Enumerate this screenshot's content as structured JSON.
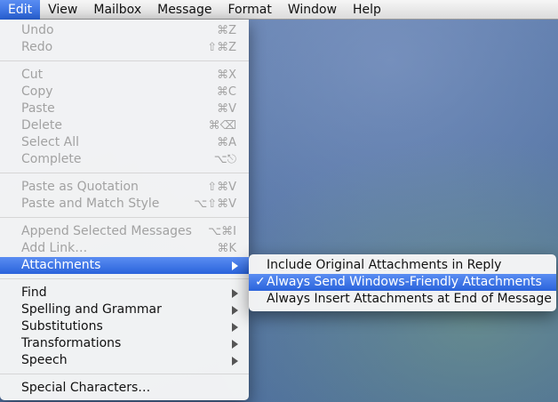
{
  "menubar": {
    "items": [
      "Edit",
      "View",
      "Mailbox",
      "Message",
      "Format",
      "Window",
      "Help"
    ]
  },
  "edit_menu": {
    "groups": [
      [
        {
          "label": "Undo",
          "shortcut": "⌘Z"
        },
        {
          "label": "Redo",
          "shortcut": "⇧⌘Z"
        }
      ],
      [
        {
          "label": "Cut",
          "shortcut": "⌘X"
        },
        {
          "label": "Copy",
          "shortcut": "⌘C"
        },
        {
          "label": "Paste",
          "shortcut": "⌘V"
        },
        {
          "label": "Delete",
          "shortcut": "⌘⌫"
        },
        {
          "label": "Select All",
          "shortcut": "⌘A"
        },
        {
          "label": "Complete",
          "shortcut": "⌥⎋"
        }
      ],
      [
        {
          "label": "Paste as Quotation",
          "shortcut": "⇧⌘V"
        },
        {
          "label": "Paste and Match Style",
          "shortcut": "⌥⇧⌘V"
        }
      ],
      [
        {
          "label": "Append Selected Messages",
          "shortcut": "⌥⌘I"
        },
        {
          "label": "Add Link…",
          "shortcut": "⌘K"
        },
        {
          "label": "Attachments"
        }
      ],
      [
        {
          "label": "Find"
        },
        {
          "label": "Spelling and Grammar"
        },
        {
          "label": "Substitutions"
        },
        {
          "label": "Transformations"
        },
        {
          "label": "Speech"
        }
      ],
      [
        {
          "label": "Special Characters…"
        }
      ]
    ]
  },
  "attachments_menu": {
    "items": [
      {
        "label": "Include Original Attachments in Reply"
      },
      {
        "label": "Always Send Windows-Friendly Attachments",
        "check": "✓"
      },
      {
        "label": "Always Insert Attachments at End of Message"
      }
    ]
  }
}
